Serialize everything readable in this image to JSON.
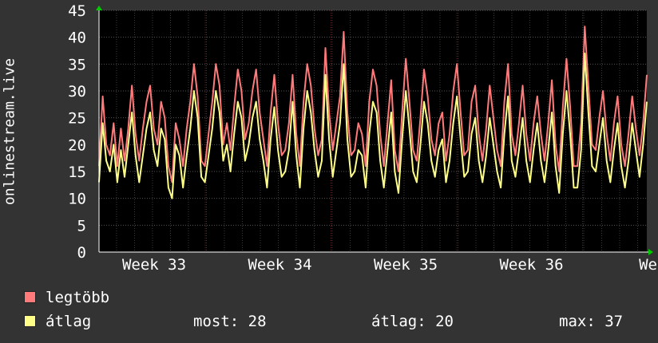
{
  "chart_data": {
    "type": "line",
    "ylabel": "onlinestream.live",
    "ylim": [
      0,
      45
    ],
    "yticks": [
      "0",
      "5",
      "10",
      "15",
      "20",
      "25",
      "30",
      "35",
      "40",
      "45"
    ],
    "xticks": [
      "Week 33",
      "Week 34",
      "Week 35",
      "Week 36",
      "Week"
    ],
    "grid": true,
    "background": "#000000",
    "series": [
      {
        "name": "legtöbb",
        "color": "#ff7a7a",
        "values": [
          16,
          29,
          20,
          18,
          24,
          16,
          23,
          17,
          23,
          31,
          22,
          17,
          23,
          28,
          31,
          23,
          20,
          28,
          25,
          16,
          13,
          24,
          21,
          16,
          23,
          28,
          35,
          29,
          17,
          16,
          22,
          28,
          35,
          31,
          20,
          24,
          19,
          27,
          34,
          30,
          21,
          24,
          30,
          34,
          26,
          21,
          16,
          26,
          33,
          24,
          18,
          19,
          24,
          33,
          22,
          16,
          28,
          35,
          31,
          23,
          18,
          21,
          38,
          26,
          19,
          24,
          29,
          41,
          26,
          18,
          19,
          24,
          22,
          16,
          28,
          34,
          31,
          22,
          16,
          24,
          32,
          19,
          15,
          26,
          36,
          28,
          19,
          17,
          25,
          34,
          29,
          21,
          18,
          24,
          26,
          17,
          22,
          30,
          35,
          26,
          18,
          19,
          28,
          31,
          22,
          17,
          23,
          31,
          25,
          19,
          16,
          28,
          35,
          22,
          18,
          24,
          31,
          22,
          17,
          24,
          29,
          22,
          17,
          24,
          32,
          20,
          15,
          27,
          36,
          27,
          16,
          16,
          24,
          42,
          31,
          20,
          19,
          25,
          30,
          22,
          17,
          24,
          29,
          20,
          16,
          22,
          29,
          23,
          18,
          24,
          33
        ]
      },
      {
        "name": "átlag",
        "color": "#ffff88",
        "values": [
          13,
          24,
          17,
          15,
          20,
          13,
          19,
          14,
          20,
          26,
          18,
          13,
          18,
          23,
          26,
          19,
          16,
          23,
          21,
          12,
          10,
          20,
          18,
          12,
          18,
          23,
          30,
          25,
          14,
          13,
          18,
          23,
          30,
          26,
          17,
          20,
          15,
          22,
          28,
          25,
          17,
          20,
          25,
          28,
          21,
          17,
          12,
          21,
          27,
          19,
          14,
          15,
          19,
          28,
          18,
          12,
          23,
          30,
          26,
          19,
          14,
          17,
          33,
          21,
          14,
          19,
          24,
          35,
          21,
          14,
          15,
          19,
          18,
          12,
          22,
          28,
          26,
          17,
          12,
          19,
          26,
          15,
          11,
          21,
          30,
          23,
          15,
          13,
          20,
          28,
          24,
          17,
          14,
          19,
          21,
          13,
          17,
          24,
          29,
          21,
          14,
          15,
          22,
          25,
          17,
          13,
          18,
          25,
          20,
          15,
          12,
          22,
          29,
          17,
          14,
          19,
          25,
          17,
          13,
          19,
          24,
          17,
          13,
          19,
          26,
          16,
          11,
          22,
          30,
          22,
          12,
          12,
          19,
          37,
          26,
          16,
          15,
          20,
          25,
          17,
          13,
          19,
          24,
          16,
          12,
          17,
          24,
          19,
          14,
          20,
          28
        ]
      }
    ]
  },
  "legend": [
    {
      "label": "legtöbb",
      "color": "#ff7a7a"
    },
    {
      "label": "átlag",
      "color": "#ffff88"
    }
  ],
  "stats": {
    "now_label": "most:",
    "now_value": "28",
    "avg_label": "átlag:",
    "avg_value": "20",
    "max_label": "max:",
    "max_value": "37"
  }
}
